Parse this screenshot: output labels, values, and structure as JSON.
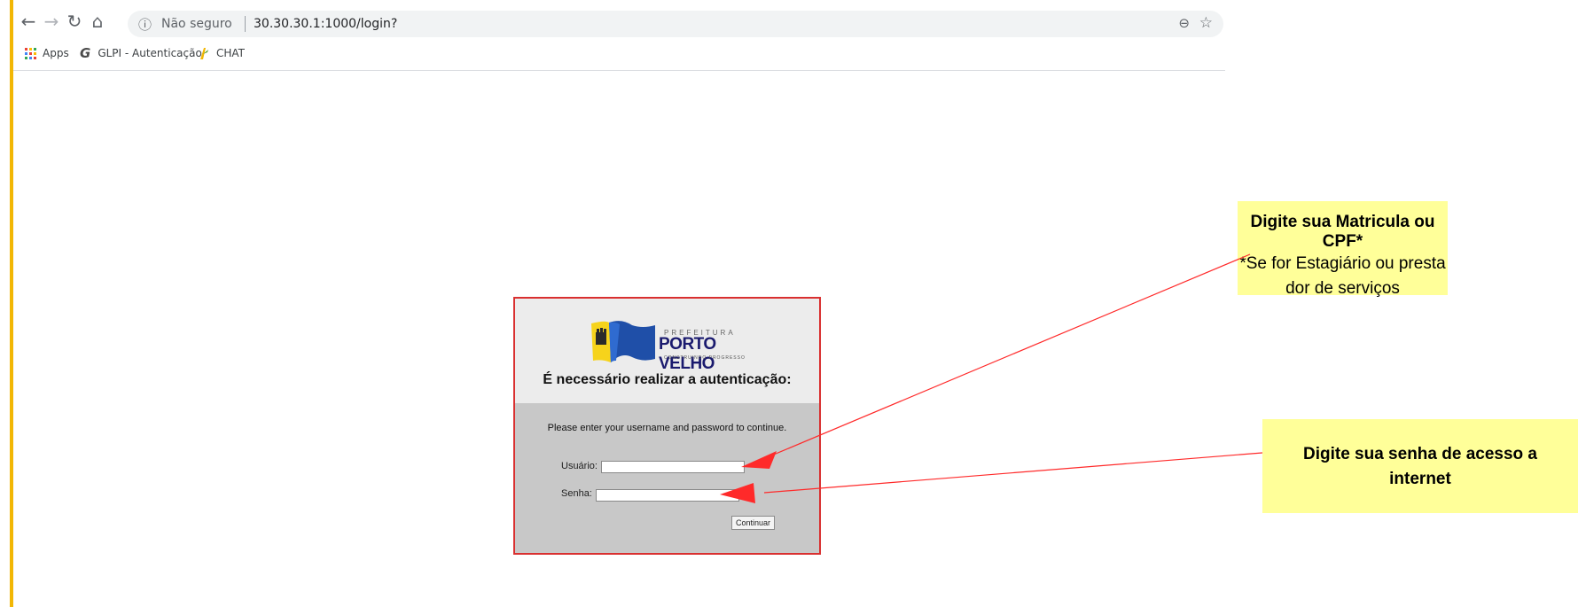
{
  "browser": {
    "address_security": "Não seguro",
    "address_url": "30.30.30.1:1000/login?",
    "bookmarks": [
      {
        "label": "Apps"
      },
      {
        "label": "GLPI - Autenticação"
      },
      {
        "label": "CHAT"
      }
    ]
  },
  "login": {
    "logo": {
      "prefix": "PREFEITURA",
      "main": "PORTO VELHO",
      "tagline": "CONSTRUINDO PROGRESSO"
    },
    "title": "É necessário realizar a autenticação:",
    "instructions": "Please enter your username and password to continue.",
    "username_label": "Usuário:",
    "username_value": "",
    "password_label": "Senha:",
    "password_value": "",
    "submit_label": "Continuar"
  },
  "annotations": [
    {
      "title": "Digite sua Matricula ou CPF*",
      "body": "*Se for Estagiário ou prestador de serviços",
      "arrow_target": "username-input"
    },
    {
      "title": "Digite sua senha de acesso a internet",
      "body": "",
      "arrow_target": "password-input"
    }
  ],
  "colors": {
    "page_accent_bar": "#f2b705",
    "login_border": "#d93030",
    "login_body": "#c8c8c8",
    "login_header": "#ececec",
    "note_background": "#ffff99",
    "arrow": "#ff2a2a"
  }
}
